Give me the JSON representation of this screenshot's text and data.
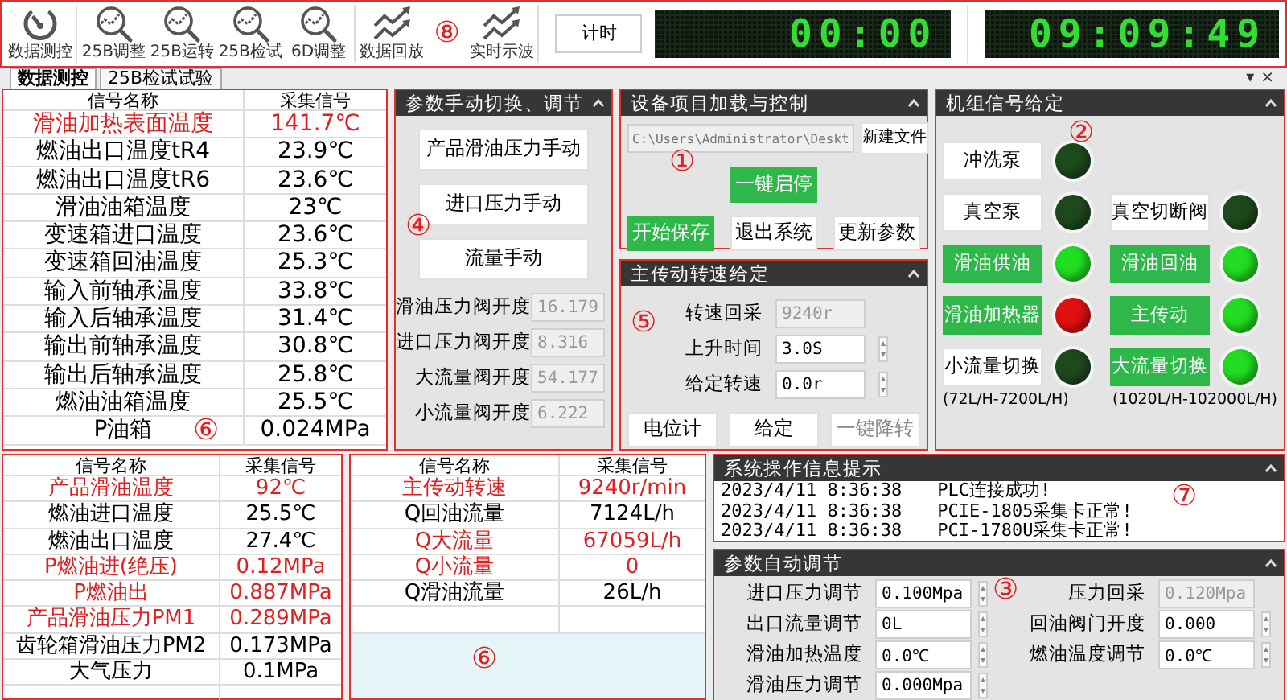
{
  "toolbar": {
    "items": [
      {
        "label": "数据测控",
        "kind": "gauge"
      },
      {
        "label": "25B调整",
        "kind": "zoom"
      },
      {
        "label": "25B运转",
        "kind": "zoom"
      },
      {
        "label": "25B检试",
        "kind": "zoom"
      },
      {
        "label": "6D调整",
        "kind": "zoom"
      },
      {
        "label": "数据回放",
        "kind": "trend"
      },
      {
        "label": "实时示波",
        "kind": "trend"
      }
    ],
    "callout": "⑧",
    "timer_button": "计时",
    "timer_display": "00:00",
    "clock_display": "09:09:49"
  },
  "tabs": [
    {
      "label": "数据测控",
      "selected": true
    },
    {
      "label": "25B检试试验",
      "selected": false
    }
  ],
  "dock_controls": [
    "▾",
    "×"
  ],
  "signal_table": {
    "columns": [
      "信号名称",
      "采集信号"
    ],
    "callout": "⑥",
    "rows": [
      {
        "name": "滑油加热表面温度",
        "value": "141.7℃",
        "alarm": true
      },
      {
        "name": "燃油出口温度tR4",
        "value": "23.9℃",
        "alarm": false
      },
      {
        "name": "燃油出口温度tR6",
        "value": "23.6℃",
        "alarm": false
      },
      {
        "name": "滑油油箱温度",
        "value": "23℃",
        "alarm": false
      },
      {
        "name": "变速箱进口温度",
        "value": "23.6℃",
        "alarm": false
      },
      {
        "name": "变速箱回油温度",
        "value": "25.3℃",
        "alarm": false
      },
      {
        "name": "输入前轴承温度",
        "value": "33.8℃",
        "alarm": false
      },
      {
        "name": "输入后轴承温度",
        "value": "31.4℃",
        "alarm": false
      },
      {
        "name": "输出前轴承温度",
        "value": "30.8℃",
        "alarm": false
      },
      {
        "name": "输出后轴承温度",
        "value": "25.8℃",
        "alarm": false
      },
      {
        "name": "燃油油箱温度",
        "value": "25.5℃",
        "alarm": false
      },
      {
        "name": "P油箱",
        "value": "0.024MPa",
        "alarm": false
      }
    ]
  },
  "manual_panel": {
    "title": "参数手动切换、调节",
    "callout": "④",
    "buttons": [
      "产品滑油压力手动",
      "进口压力手动",
      "流量手动"
    ],
    "fields": [
      {
        "label": "滑油压力阀开度",
        "value": "16.179",
        "disabled": true
      },
      {
        "label": "进口压力阀开度",
        "value": "8.316",
        "disabled": true
      },
      {
        "label": "大流量阀开度",
        "value": "54.177",
        "disabled": true
      },
      {
        "label": "小流量阀开度",
        "value": "6.222",
        "disabled": true
      }
    ]
  },
  "project_panel": {
    "title": "设备项目加载与控制",
    "callout": "①",
    "path": "C:\\Users\\Administrator\\Deskt",
    "new_file_button": "新建文件",
    "start_stop_button": {
      "label": "一键启停",
      "active": true
    },
    "buttons": [
      {
        "label": "开始保存",
        "active": true
      },
      {
        "label": "退出系统",
        "active": false
      },
      {
        "label": "更新参数",
        "active": false
      }
    ]
  },
  "speed_panel": {
    "title": "主传动转速给定",
    "callout": "⑤",
    "fields": [
      {
        "label": "转速回采",
        "value": "9240r",
        "disabled": true
      },
      {
        "label": "上升时间",
        "value": "3.0S",
        "disabled": false
      },
      {
        "label": "给定转速",
        "value": "0.0r",
        "disabled": false
      }
    ],
    "buttons": [
      {
        "label": "电位计",
        "disabled": false
      },
      {
        "label": "给定",
        "disabled": false
      },
      {
        "label": "一键降转",
        "disabled": true
      }
    ]
  },
  "unit_panel": {
    "title": "机组信号给定",
    "callout": "②",
    "rows": [
      {
        "items": [
          {
            "label": "冲洗泵",
            "active": false,
            "color": "#1d4a1d"
          }
        ]
      },
      {
        "items": [
          {
            "label": "真空泵",
            "active": false,
            "color": "#1d4a1d"
          },
          {
            "label": "真空切断阀",
            "active": false,
            "color": "#1d4a1d"
          }
        ]
      },
      {
        "items": [
          {
            "label": "滑油供油",
            "active": true,
            "color": "#22dd22"
          },
          {
            "label": "滑油回油",
            "active": true,
            "color": "#22dd22"
          }
        ]
      },
      {
        "items": [
          {
            "label": "滑油加热器",
            "active": true,
            "color": "#e01010"
          },
          {
            "label": "主传动",
            "active": true,
            "color": "#22dd22"
          }
        ]
      },
      {
        "items": [
          {
            "label": "小流量切换",
            "active": false,
            "color": "#1d4a1d"
          },
          {
            "label": "大流量切换",
            "active": true,
            "color": "#22dd22"
          }
        ]
      }
    ],
    "notes": [
      "(72L/H-7200L/H)",
      "(1020L/H-102000L/H)"
    ]
  },
  "bottom_table_left": {
    "columns": [
      "信号名称",
      "采集信号"
    ],
    "rows": [
      {
        "name": "产品滑油温度",
        "value": "92℃",
        "alarm": true
      },
      {
        "name": "燃油进口温度",
        "value": "25.5℃",
        "alarm": false
      },
      {
        "name": "燃油出口温度",
        "value": "27.4℃",
        "alarm": false
      },
      {
        "name": "P燃油进(绝压)",
        "value": "0.12MPa",
        "alarm": true
      },
      {
        "name": "P燃油出",
        "value": "0.887MPa",
        "alarm": true
      },
      {
        "name": "产品滑油压力PM1",
        "value": "0.289MPa",
        "alarm": true
      },
      {
        "name": "齿轮箱滑油压力PM2",
        "value": "0.173MPa",
        "alarm": false
      },
      {
        "name": "大气压力",
        "value": "0.1MPa",
        "alarm": false
      }
    ]
  },
  "bottom_table_right": {
    "columns": [
      "信号名称",
      "采集信号"
    ],
    "callout": "⑥",
    "rows": [
      {
        "name": "主传动转速",
        "value": "9240r/min",
        "alarm": true
      },
      {
        "name": "Q回油流量",
        "value": "7124L/h",
        "alarm": false
      },
      {
        "name": "Q大流量",
        "value": "67059L/h",
        "alarm": true
      },
      {
        "name": "Q小流量",
        "value": "0",
        "alarm": true
      },
      {
        "name": "Q滑油流量",
        "value": "26L/h",
        "alarm": false
      }
    ]
  },
  "log_panel": {
    "title": "系统操作信息提示",
    "callout": "⑦",
    "entries": [
      {
        "time": "2023/4/11 8:36:38",
        "message": "PLC连接成功!"
      },
      {
        "time": "2023/4/11 8:36:38",
        "message": "PCIE-1805采集卡正常!"
      },
      {
        "time": "2023/4/11 8:36:38",
        "message": "PCI-1780U采集卡正常!"
      }
    ]
  },
  "auto_panel": {
    "title": "参数自动调节",
    "callout": "③",
    "fields": [
      {
        "label": "进口压力调节",
        "value": "0.100Mpa",
        "disabled": false
      },
      {
        "label": "压力回采",
        "value": "0.120Mpa",
        "disabled": true
      },
      {
        "label": "出口流量调节",
        "value": "0L",
        "disabled": false
      },
      {
        "label": "回油阀门开度",
        "value": "0.000",
        "disabled": false
      },
      {
        "label": "滑油加热温度",
        "value": "0.0℃",
        "disabled": false
      },
      {
        "label": "燃油温度调节",
        "value": "0.0℃",
        "disabled": false
      },
      {
        "label": "滑油压力调节",
        "value": "0.000Mpa",
        "disabled": false
      }
    ]
  }
}
